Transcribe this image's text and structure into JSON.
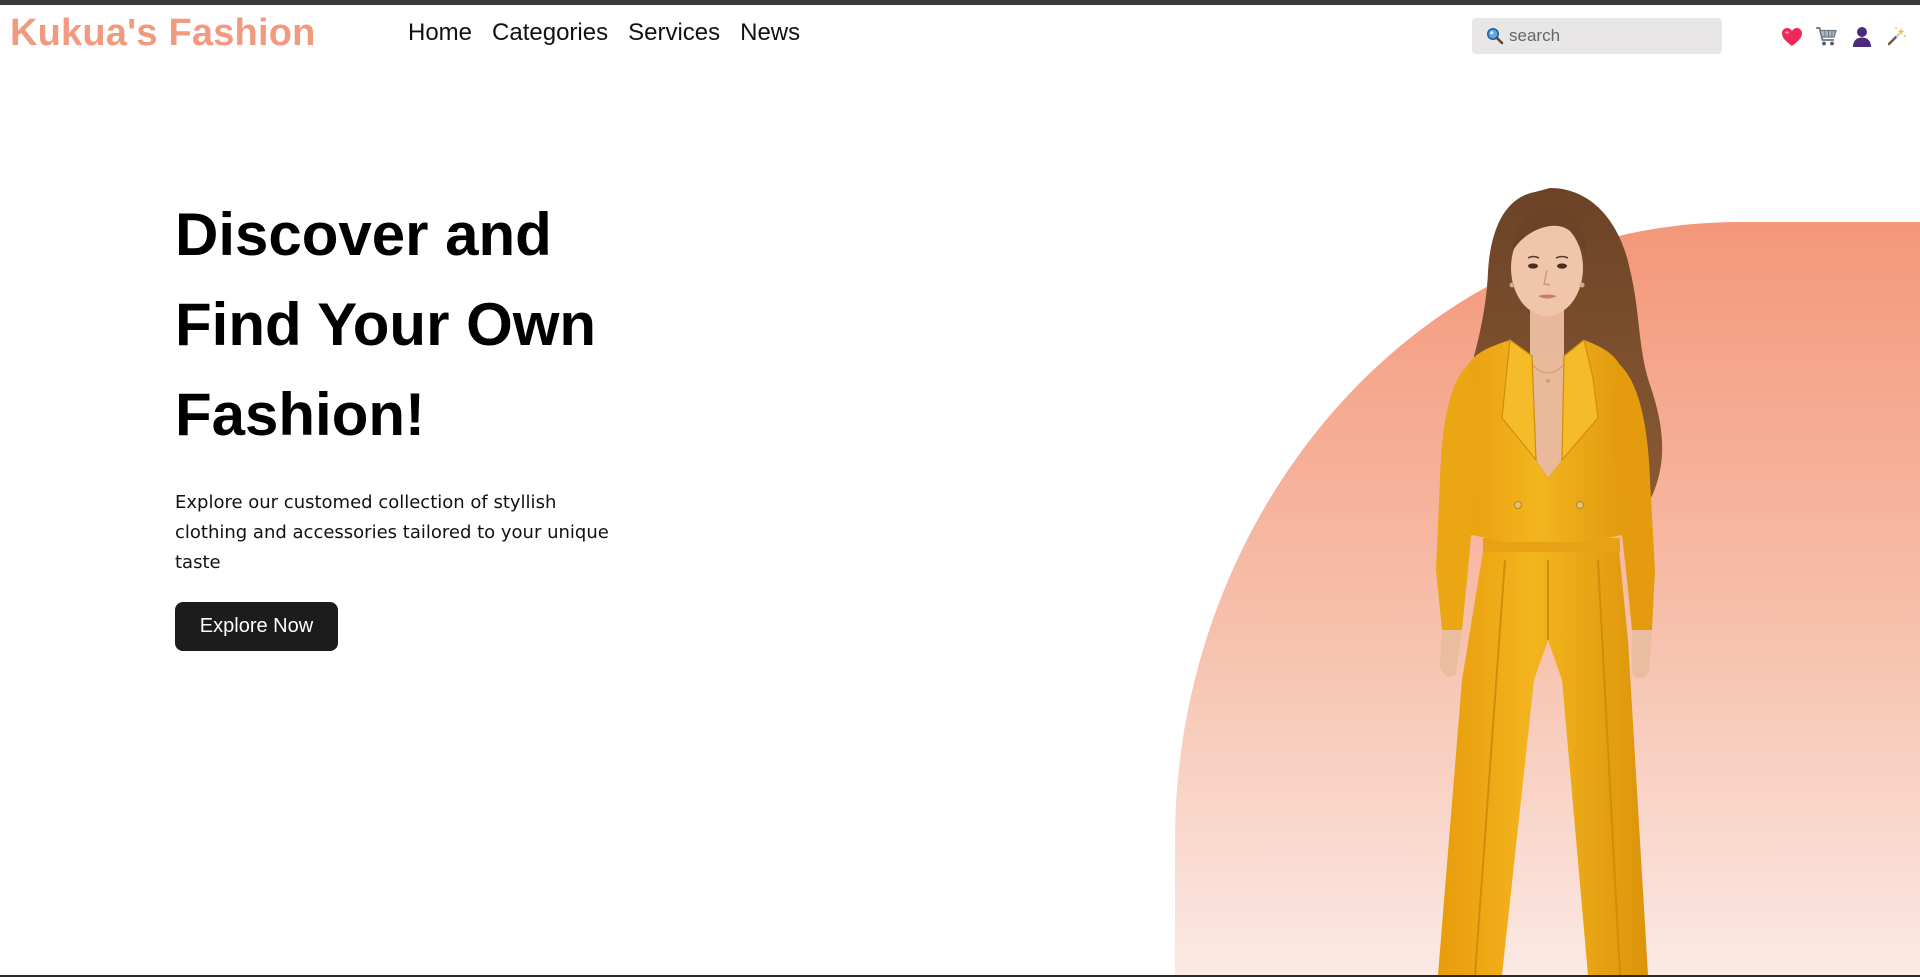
{
  "header": {
    "brand": "Kukua's Fashion",
    "nav": [
      {
        "label": "Home"
      },
      {
        "label": "Categories"
      },
      {
        "label": "Services"
      },
      {
        "label": "News"
      }
    ],
    "search": {
      "placeholder": "search",
      "value": ""
    },
    "icons": [
      "heart-icon",
      "cart-icon",
      "user-icon",
      "magic-wand-icon"
    ]
  },
  "hero": {
    "title_lines": [
      "Discover and",
      "Find Your Own",
      "Fashion!"
    ],
    "description": "Explore our customed collection of styllish clothing and accessories tailored to your unique taste",
    "cta_label": "Explore Now"
  },
  "colors": {
    "brand": "#f29a7f",
    "accent_gradient_top": "#f4977a",
    "accent_gradient_bottom": "#fbe9e4",
    "button": "#1c1c1c",
    "outfit": "#f0ac14"
  }
}
